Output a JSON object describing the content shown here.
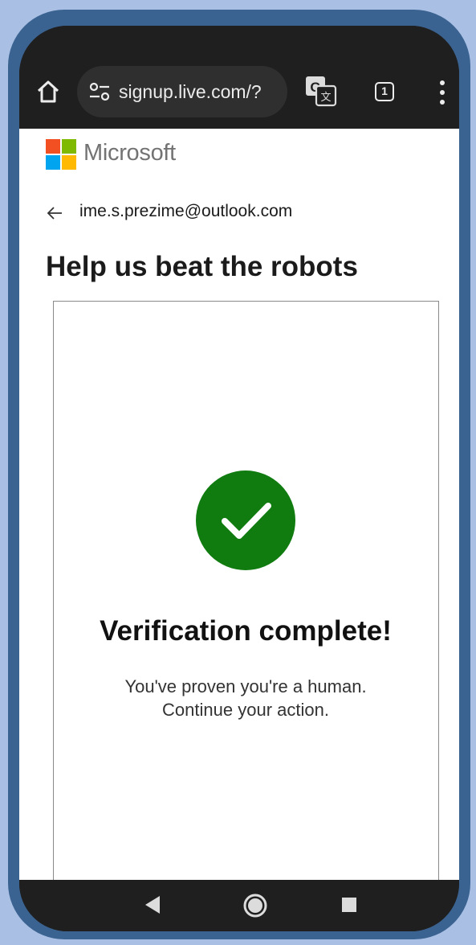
{
  "browser": {
    "url": "signup.live.com/?",
    "tab_count": "1",
    "icons": {
      "home": "home-icon",
      "site_settings": "tune-icon",
      "translate": "translate-icon",
      "tabs": "tab-switcher-icon",
      "menu": "more-vert-icon"
    }
  },
  "page": {
    "brand": "Microsoft",
    "brand_colors": [
      "#f25022",
      "#7fba00",
      "#00a4ef",
      "#ffb900"
    ],
    "account_email": "ime.s.prezime@outlook.com",
    "heading": "Help us beat the robots",
    "verification": {
      "status_icon": "check-circle-icon",
      "status_color": "#107c10",
      "title": "Verification complete!",
      "message_line1": "You've proven you're a human.",
      "message_line2": "Continue your action."
    }
  },
  "navigation_bar": {
    "icons": [
      "back-triangle-icon",
      "home-circle-icon",
      "recents-square-icon"
    ]
  }
}
